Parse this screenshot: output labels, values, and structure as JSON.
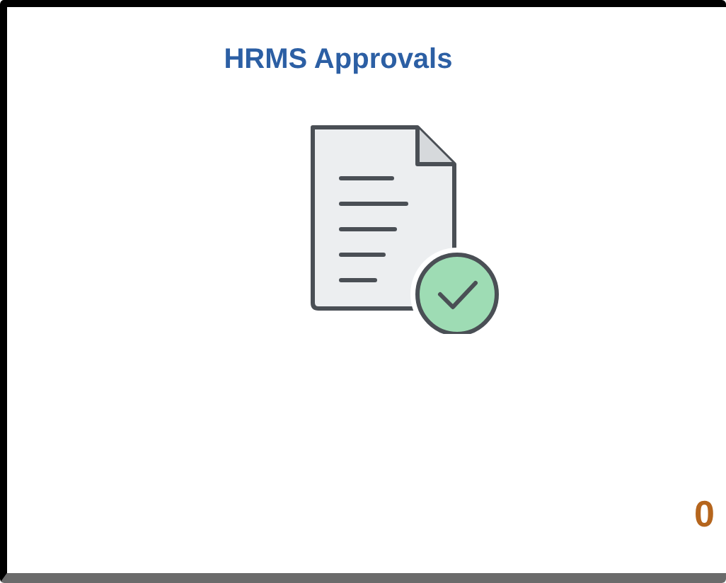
{
  "tile": {
    "title": "HRMS Approvals",
    "count": "0"
  }
}
